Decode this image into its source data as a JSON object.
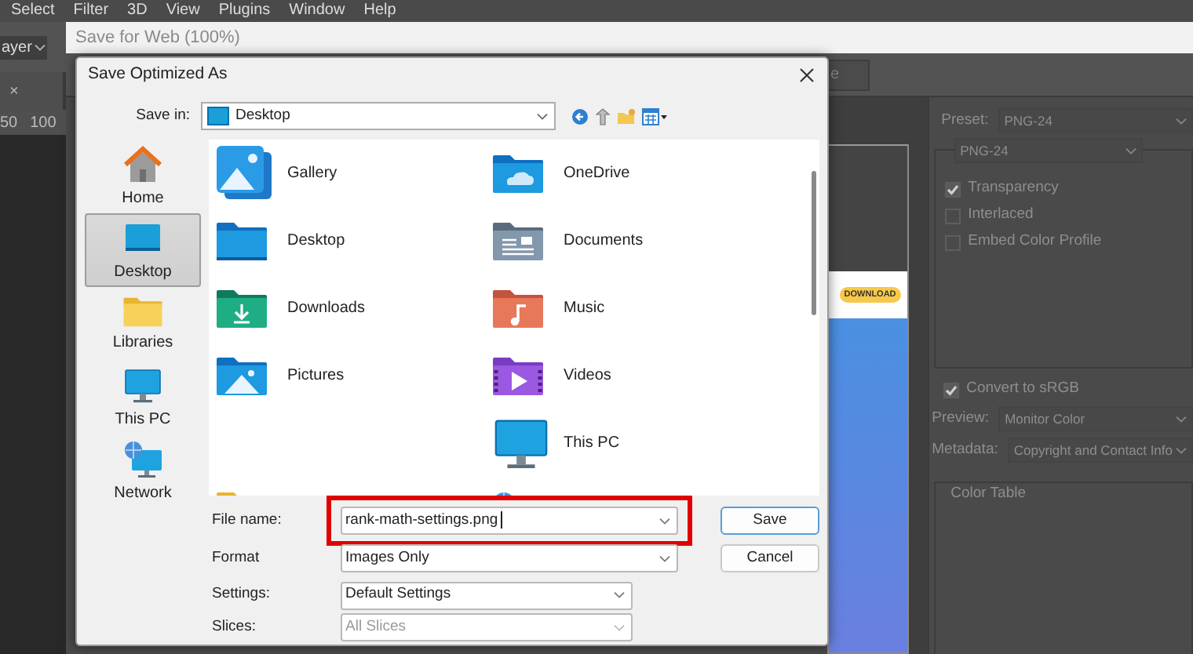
{
  "menu_bar": [
    {
      "label": "Select"
    },
    {
      "label": "Filter"
    },
    {
      "label": "3D"
    },
    {
      "label": "View"
    },
    {
      "label": "Plugins"
    },
    {
      "label": "Window"
    },
    {
      "label": "Help"
    }
  ],
  "options_bar": {
    "dropdown": "ayer"
  },
  "document_tab": {
    "close": "×"
  },
  "ruler": [
    "50",
    "100"
  ],
  "save_for_web": {
    "title": "Save for Web (100%)",
    "toolbar_button": "e",
    "preview": {
      "button": "DOWNLOAD"
    },
    "settings": {
      "preset_label": "Preset:",
      "preset": "PNG-24",
      "format": "PNG-24",
      "options": [
        {
          "label": "Transparency",
          "checked": true
        },
        {
          "label": "Interlaced",
          "checked": false
        },
        {
          "label": "Embed Color Profile",
          "checked": false
        }
      ],
      "convert": {
        "label": "Convert to sRGB",
        "checked": true
      },
      "preview_label": "Preview:",
      "preview_value": "Monitor Color",
      "metadata_label": "Metadata:",
      "metadata_value": "Copyright and Contact Info",
      "color_table": "Color Table"
    }
  },
  "dialog": {
    "title": "Save Optimized As",
    "save_in_label": "Save in:",
    "save_in": "Desktop",
    "places": [
      {
        "label": "Home",
        "kind": "home",
        "selected": false
      },
      {
        "label": "Desktop",
        "kind": "desktop",
        "selected": true
      },
      {
        "label": "Libraries",
        "kind": "libraries",
        "selected": false
      },
      {
        "label": "This PC",
        "kind": "pc",
        "selected": false
      },
      {
        "label": "Network",
        "kind": "network",
        "selected": false
      }
    ],
    "files": {
      "columns": [
        [
          {
            "label": "Gallery",
            "kind": "gallery"
          },
          {
            "label": "Desktop",
            "kind": "desktop"
          },
          {
            "label": "Downloads",
            "kind": "downloads"
          },
          {
            "label": "Pictures",
            "kind": "pictures"
          },
          {
            "kind": "spacer"
          },
          {
            "kind": "folder"
          }
        ],
        [
          {
            "label": "OneDrive",
            "kind": "onedrive"
          },
          {
            "label": "Documents",
            "kind": "documents"
          },
          {
            "label": "Music",
            "kind": "music"
          },
          {
            "label": "Videos",
            "kind": "videos"
          },
          {
            "label": "This PC",
            "kind": "pc"
          },
          {
            "kind": "network"
          }
        ]
      ]
    },
    "fields": [
      {
        "label": "File name:",
        "value": "rank-math-settings.png",
        "kind": "input",
        "highlighted": true,
        "disabled": false
      },
      {
        "label": "Format",
        "value": "Images Only",
        "kind": "combo",
        "highlighted": false,
        "disabled": false
      },
      {
        "label": "Settings:",
        "value": "Default Settings",
        "kind": "combo",
        "highlighted": false,
        "disabled": false
      },
      {
        "label": "Slices:",
        "value": "All Slices",
        "kind": "combo",
        "highlighted": false,
        "disabled": true
      }
    ],
    "buttons": [
      {
        "label": "Save",
        "default": true
      },
      {
        "label": "Cancel",
        "default": false
      }
    ]
  }
}
